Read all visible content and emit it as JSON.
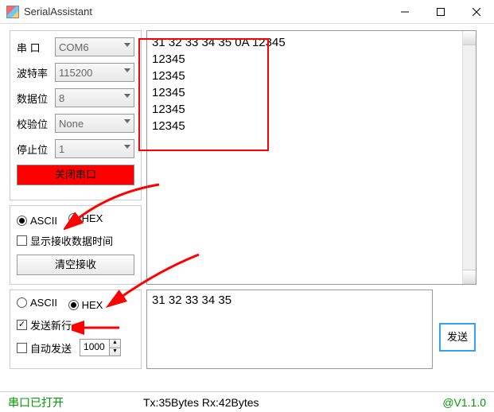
{
  "window": {
    "title": "SerialAssistant"
  },
  "serial": {
    "port_label": "串 口",
    "port_value": "COM6",
    "baud_label": "波特率",
    "baud_value": "115200",
    "data_label": "数据位",
    "data_value": "8",
    "parity_label": "校验位",
    "parity_value": "None",
    "stop_label": "停止位",
    "stop_value": "1",
    "close_label": "关闭串口"
  },
  "rx": {
    "ascii_label": "ASCII",
    "hex_label": "HEX",
    "show_time_label": "显示接收数据时间",
    "clear_label": "清空接收",
    "lines": [
      "31 32 33 34 35 0A 12345",
      "12345",
      "12345",
      "12345",
      "12345",
      "12345"
    ]
  },
  "tx": {
    "ascii_label": "ASCII",
    "hex_label": "HEX",
    "newline_label": "发送新行",
    "auto_label": "自动发送",
    "auto_interval": "1000",
    "send_label": "发送",
    "text": "31 32 33  34 35"
  },
  "status": {
    "port_state": "串口已打开",
    "bytes": "Tx:35Bytes   Rx:42Bytes",
    "version": "@V1.1.0"
  }
}
